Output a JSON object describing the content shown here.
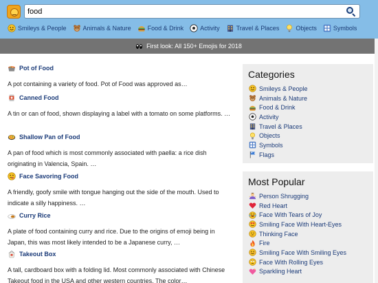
{
  "search": {
    "value": "food",
    "placeholder": ""
  },
  "nav": [
    {
      "label": "Smileys & People",
      "icon": "smiley-icon"
    },
    {
      "label": "Animals & Nature",
      "icon": "bear-icon"
    },
    {
      "label": "Food & Drink",
      "icon": "burger-icon"
    },
    {
      "label": "Activity",
      "icon": "soccer-ball-icon"
    },
    {
      "label": "Travel & Places",
      "icon": "building-icon"
    },
    {
      "label": "Objects",
      "icon": "lightbulb-icon"
    },
    {
      "label": "Symbols",
      "icon": "symbols-icon"
    }
  ],
  "banner": {
    "text": "First look: All 150+ Emojis for 2018"
  },
  "results": [
    {
      "title": "Pot of Food",
      "icon": "pot-of-food-icon",
      "desc": "A pot containing a variety of food. Pot of Food was approved as…"
    },
    {
      "title": "Canned Food",
      "icon": "canned-food-icon",
      "desc": "A tin or can of food, shown displaying a label with a tomato on some platforms. …"
    },
    {
      "title": "Shallow Pan of Food",
      "icon": "paella-pan-icon",
      "desc": "A pan of food which is most commonly associated with paella: a rice dish originating in Valencia, Spain. …"
    },
    {
      "title": "Face Savoring Food",
      "icon": "savoring-face-icon",
      "desc": "A friendly, goofy smile with tongue hanging out the side of the mouth. Used to indicate a silly happiness. …"
    },
    {
      "title": "Curry Rice",
      "icon": "curry-rice-icon",
      "desc": "A plate of food containing curry and rice. Due to the origins of emoji being in Japan, this was most likely intended to be a Japanese curry, …"
    },
    {
      "title": "Takeout Box",
      "icon": "takeout-box-icon",
      "desc": "A tall, cardboard box with a folding lid. Most commonly associated with Chinese Takeout food in the USA and other western countries. The color…"
    }
  ],
  "categories": {
    "heading": "Categories",
    "items": [
      {
        "label": "Smileys & People",
        "icon": "smiley-icon"
      },
      {
        "label": "Animals & Nature",
        "icon": "bear-icon"
      },
      {
        "label": "Food & Drink",
        "icon": "burger-icon"
      },
      {
        "label": "Activity",
        "icon": "soccer-ball-icon"
      },
      {
        "label": "Travel & Places",
        "icon": "building-icon"
      },
      {
        "label": "Objects",
        "icon": "lightbulb-icon"
      },
      {
        "label": "Symbols",
        "icon": "symbols-icon"
      },
      {
        "label": "Flags",
        "icon": "flag-icon"
      }
    ]
  },
  "popular": {
    "heading": "Most Popular",
    "items": [
      {
        "label": "Person Shrugging",
        "icon": "shrug-icon"
      },
      {
        "label": "Red Heart",
        "icon": "red-heart-icon"
      },
      {
        "label": "Face With Tears of Joy",
        "icon": "tears-of-joy-icon"
      },
      {
        "label": "Smiling Face With Heart-Eyes",
        "icon": "heart-eyes-icon"
      },
      {
        "label": "Thinking Face",
        "icon": "thinking-face-icon"
      },
      {
        "label": "Fire",
        "icon": "fire-icon"
      },
      {
        "label": "Smiling Face With Smiling Eyes",
        "icon": "smiling-eyes-icon"
      },
      {
        "label": "Face With Rolling Eyes",
        "icon": "rolling-eyes-icon"
      },
      {
        "label": "Sparkling Heart",
        "icon": "sparkling-heart-icon"
      }
    ]
  },
  "colors": {
    "topbar": "#85bde7",
    "link": "#1a3a78",
    "banner": "#737373",
    "sidebar": "#ededed"
  }
}
